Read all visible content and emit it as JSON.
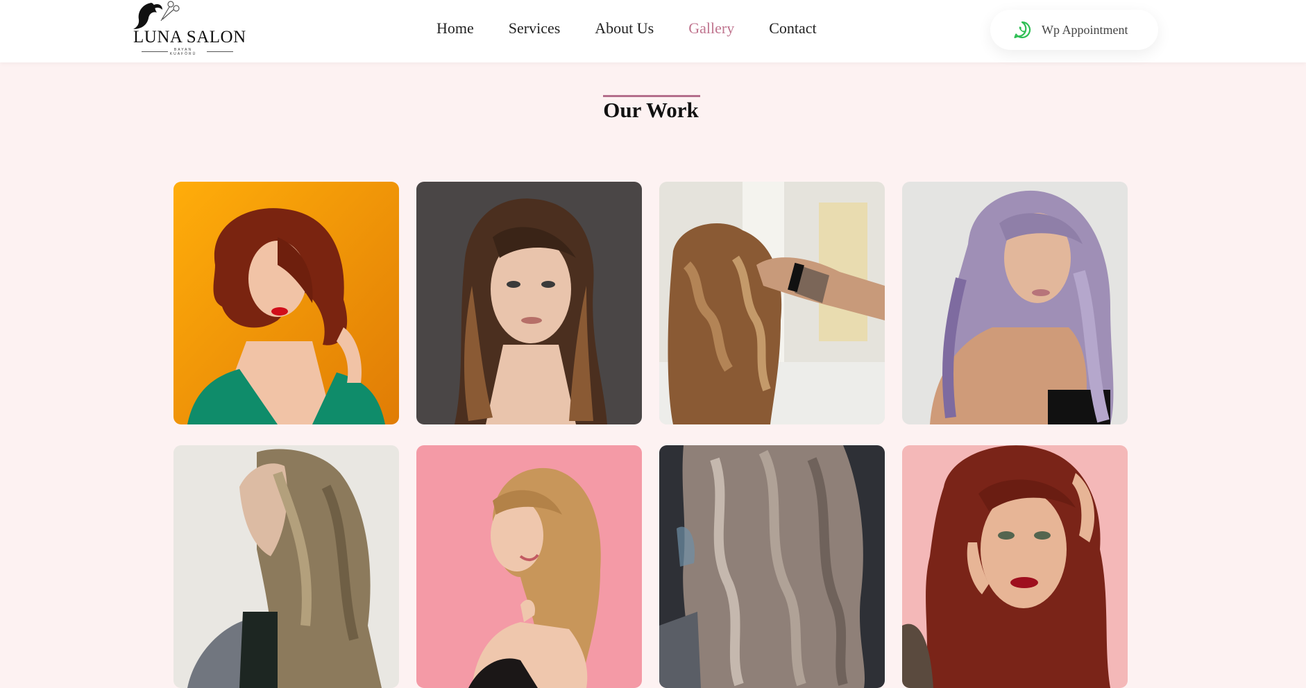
{
  "brand": {
    "name": "LUNA SALON",
    "sub1": "BAYAN",
    "sub2": "KUAFÖRÜ"
  },
  "nav": {
    "items": [
      {
        "label": "Home",
        "active": false
      },
      {
        "label": "Services",
        "active": false
      },
      {
        "label": "About Us",
        "active": false
      },
      {
        "label": "Gallery",
        "active": true
      },
      {
        "label": "Contact",
        "active": false
      }
    ]
  },
  "cta": {
    "label": "Wp Appointment",
    "icon": "whatsapp-icon"
  },
  "section": {
    "title": "Our Work"
  },
  "gallery": {
    "items": [
      {
        "name": "gallery-photo-red-curly-hair-orange-background",
        "bg": "#f5a623",
        "hair": "#7a2410"
      },
      {
        "name": "gallery-photo-brown-hair-grey-background",
        "bg": "#4a4646",
        "hair": "#5a3a26"
      },
      {
        "name": "gallery-photo-balayane-waves-stylist",
        "bg": "#d9d6cc",
        "hair": "#8a5a34"
      },
      {
        "name": "gallery-photo-lavender-hair",
        "bg": "#e4e4e2",
        "hair": "#9f8fb6"
      },
      {
        "name": "gallery-photo-ash-blonde-waves-profile",
        "bg": "#e8e6e0",
        "hair": "#8c7a5c"
      },
      {
        "name": "gallery-photo-blonde-pink-background",
        "bg": "#f49aa6",
        "hair": "#c8965a"
      },
      {
        "name": "gallery-photo-silver-waves-dark-background",
        "bg": "#2e3036",
        "hair": "#8f8078"
      },
      {
        "name": "gallery-photo-red-hair-glitter-makeup",
        "bg": "#f4b8b8",
        "hair": "#7a2418"
      }
    ]
  }
}
